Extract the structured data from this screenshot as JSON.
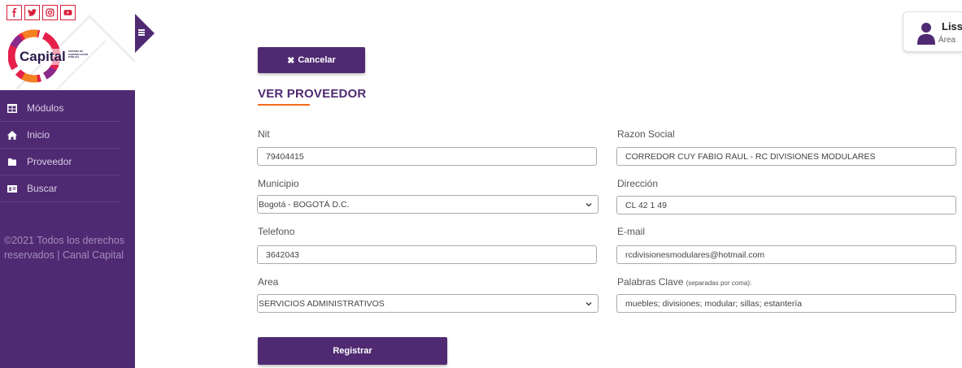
{
  "social": [
    "facebook-icon",
    "twitter-icon",
    "instagram-icon",
    "youtube-icon"
  ],
  "brand": {
    "logo_text": "Capital",
    "logo_sub": "SISTEMA DE COMUNICACIÓN PÚBLICA"
  },
  "sidebar": {
    "items": [
      {
        "label": "Módulos",
        "icon": "modules-icon"
      },
      {
        "label": "Inicio",
        "icon": "home-icon"
      },
      {
        "label": "Proveedor",
        "icon": "folder-icon"
      },
      {
        "label": "Buscar",
        "icon": "id-card-icon"
      }
    ],
    "copyright": "©2021 Todos los derechos reservados | Canal Capital"
  },
  "user": {
    "name": "Liss",
    "area": "Área"
  },
  "actions": {
    "cancel_label": "Cancelar",
    "register_label": "Registrar"
  },
  "page": {
    "title": "VER PROVEEDOR"
  },
  "form": {
    "nit": {
      "label": "Nit",
      "value": "79404415"
    },
    "razon_social": {
      "label": "Razon Social",
      "value": "CORREDOR CUY FABIO RAUL - RC DIVISIONES MODULARES"
    },
    "municipio": {
      "label": "Municipio",
      "value": "Bogotá - BOGOTÁ D.C."
    },
    "direccion": {
      "label": "Dirección",
      "value": "CL 42 1 49"
    },
    "telefono": {
      "label": "Telefono",
      "value": "3642043"
    },
    "email": {
      "label": "E-mail",
      "value": "rcdivisionesmodulares@hotmail.com"
    },
    "area": {
      "label": "Area",
      "value": "SERVICIOS ADMINISTRATIVOS"
    },
    "palabras_clave": {
      "label": "Palabras Clave",
      "hint": "(separadas por coma):",
      "value": "muebles; divisiones; modular; sillas; estantería"
    }
  },
  "colors": {
    "primary": "#4f2a72",
    "accent": "#f06b1a",
    "social": "#d81e3a"
  }
}
